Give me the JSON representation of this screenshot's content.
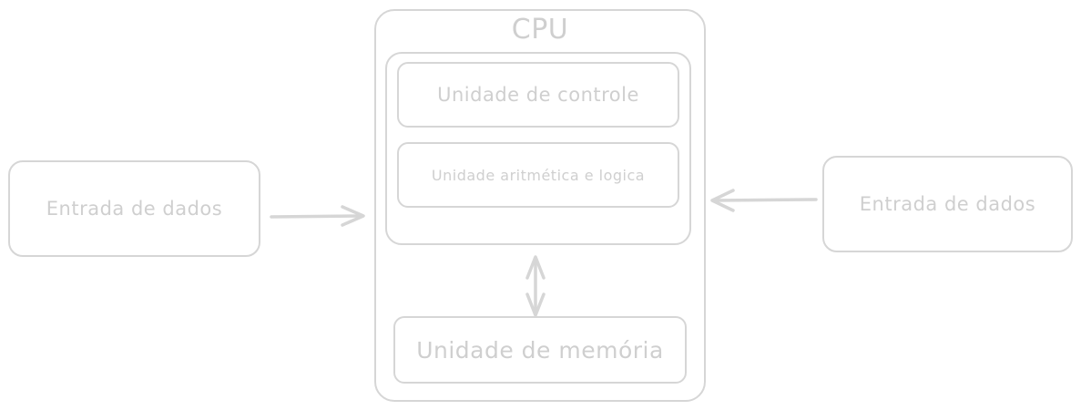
{
  "diagram": {
    "cpu": {
      "title": "CPU"
    },
    "control_unit": {
      "label": "Unidade de controle"
    },
    "alu": {
      "label": "Unidade aritmética e logica"
    },
    "memory_unit": {
      "label": "Unidade de memória"
    },
    "input_left": {
      "label": "Entrada de dados"
    },
    "input_right": {
      "label": "Entrada de dados"
    }
  },
  "colors": {
    "stroke": "#d6d6d6",
    "text": "#cfcfcf",
    "background": "#ffffff"
  }
}
